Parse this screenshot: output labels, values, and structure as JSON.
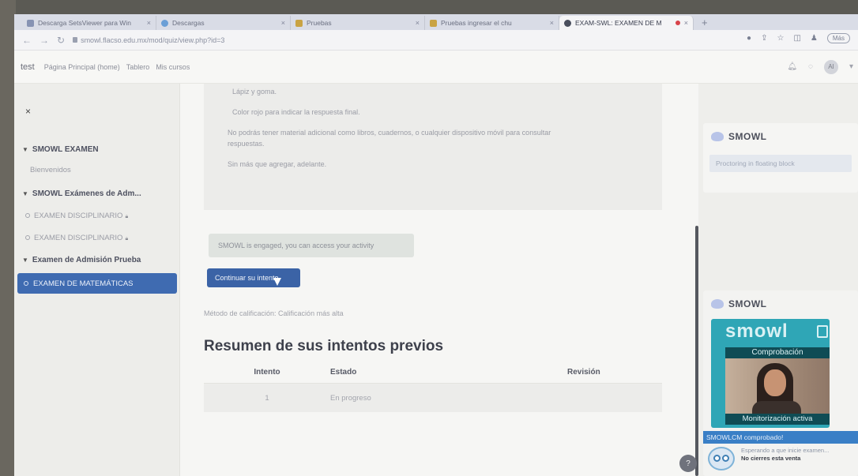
{
  "browser": {
    "tabs": [
      {
        "label": "Descarga SetsViewer para Win",
        "icon": "download-page-icon",
        "active": false
      },
      {
        "label": "Descargas",
        "icon": "download-icon",
        "active": false
      },
      {
        "label": "Pruebas",
        "icon": "flacso-icon",
        "active": false
      },
      {
        "label": "Pruebas ingresar el chu",
        "icon": "flacso-icon",
        "active": false
      },
      {
        "label": "EXAM-SWL: EXAMEN DE M",
        "icon": "smowl-icon",
        "active": true
      }
    ],
    "new_tab": "+",
    "url": "smowl.flacso.edu.mx/mod/quiz/view.php?id=3",
    "more_label": "Más"
  },
  "topnav": {
    "brand": "test",
    "links": [
      "Página Principal (home)",
      "Tablero",
      "Mis cursos"
    ],
    "avatar": "AI"
  },
  "drawer": {
    "close": "×",
    "sections": [
      {
        "title": "SMOWL EXAMEN",
        "items": [
          "Bienvenidos"
        ]
      },
      {
        "title": "SMOWL Exámenes de Adm...",
        "items": [
          "EXAMEN DISCIPLINARIO",
          "EXAMEN DISCIPLINARIO"
        ]
      },
      {
        "title": "Examen de Admisión Prueba",
        "items": []
      }
    ],
    "active_item": "EXAMEN DE MATEMÁTICAS"
  },
  "main": {
    "info_lines": [
      "Lápiz y goma.",
      "Color rojo para indicar la respuesta final.",
      "No podrás tener material adicional como libros, cuadernos, o cualquier dispositivo móvil para consultar",
      "respuestas.",
      "Sin más que agregar, adelante."
    ],
    "engaged_msg": "SMOWL is engaged, you can access your activity",
    "continue_label": "Continuar su intento",
    "grading_method": "Método de calificación: Calificación más alta",
    "summary_title": "Resumen de sus intentos previos",
    "table": {
      "headers": [
        "Intento",
        "Estado",
        "Revisión"
      ],
      "rows": [
        [
          "1",
          "En progreso",
          ""
        ]
      ]
    },
    "help_label": "?"
  },
  "right": {
    "block1_title": "SMOWL",
    "block1_text": "Proctoring in floating block",
    "block2_title": "SMOWL",
    "wordmark": "smowl",
    "check_label": "Comprobación",
    "monitor_label": "Monitorización activa",
    "lcm_status": "SMOWLCM comprobado!",
    "waiting_text": "Esperando a que inicie examen...",
    "waiting_warning": "No cierres esta venta"
  }
}
